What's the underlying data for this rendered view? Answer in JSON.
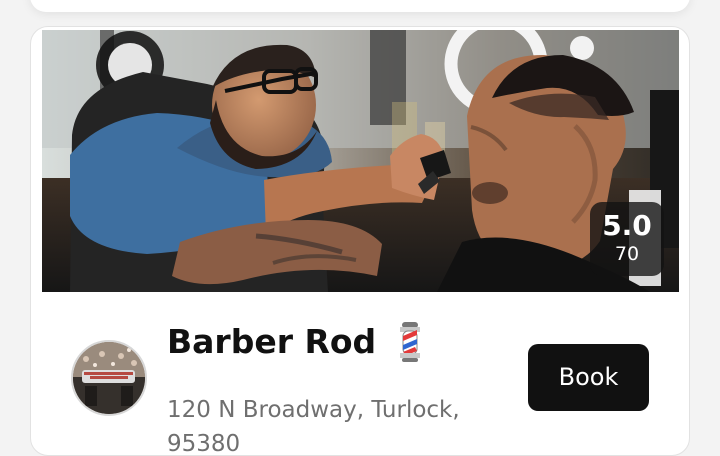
{
  "listing": {
    "name": "Barber Rod",
    "emoji_icon": "barber-pole-icon",
    "address": "120 N Broadway, Turlock, 95380",
    "book_label": "Book",
    "rating": {
      "score": "5.0",
      "count": "70"
    }
  },
  "colors": {
    "background": "#f3f3f3",
    "card": "#ffffff",
    "button": "#111111",
    "button_text": "#ffffff",
    "muted_text": "#6f6f6f",
    "badge": "#121212"
  }
}
